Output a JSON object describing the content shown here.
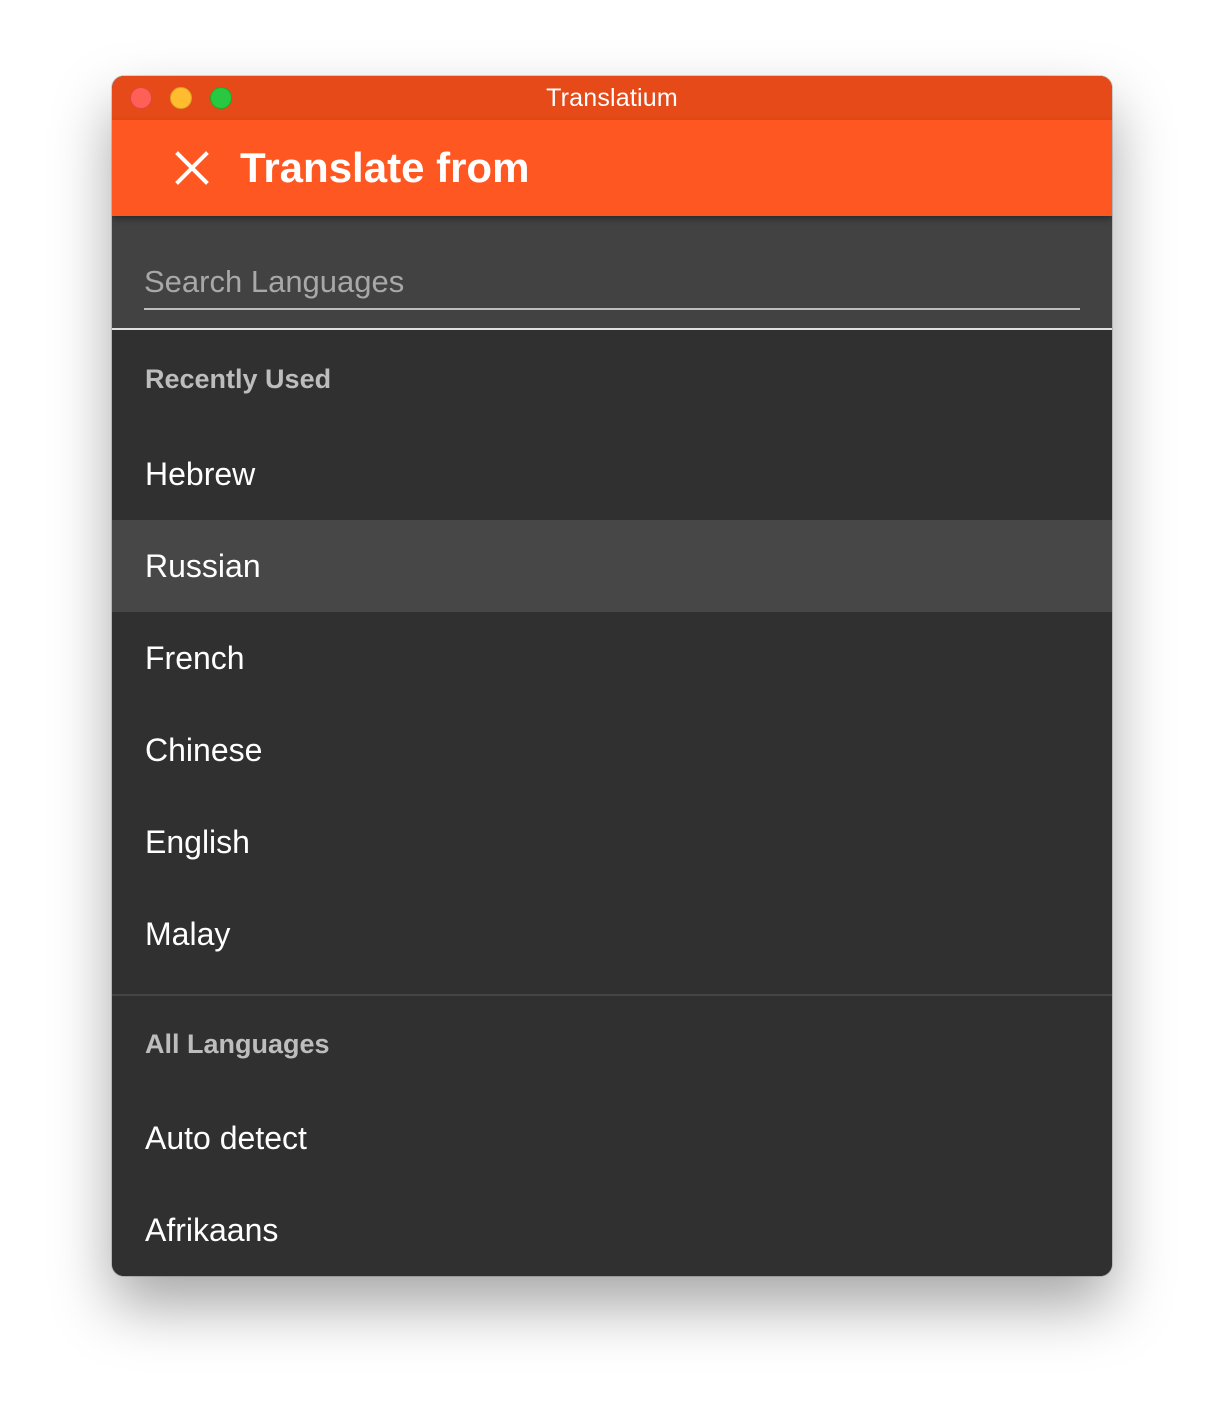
{
  "window": {
    "title": "Translatium"
  },
  "appbar": {
    "title": "Translate from",
    "close_icon": "close-icon"
  },
  "search": {
    "placeholder": "Search Languages",
    "value": ""
  },
  "recent": {
    "header": "Recently Used",
    "items": [
      {
        "label": "Hebrew"
      },
      {
        "label": "Russian"
      },
      {
        "label": "French"
      },
      {
        "label": "Chinese"
      },
      {
        "label": "English"
      },
      {
        "label": "Malay"
      }
    ],
    "selected_index": 1
  },
  "all": {
    "header": "All Languages",
    "items": [
      {
        "label": "Auto detect"
      },
      {
        "label": "Afrikaans"
      }
    ]
  },
  "colors": {
    "titlebar": "#e64a19",
    "appbar": "#ff5722",
    "list_background": "#303030",
    "search_background": "#424242",
    "selected_row": "#474747"
  }
}
